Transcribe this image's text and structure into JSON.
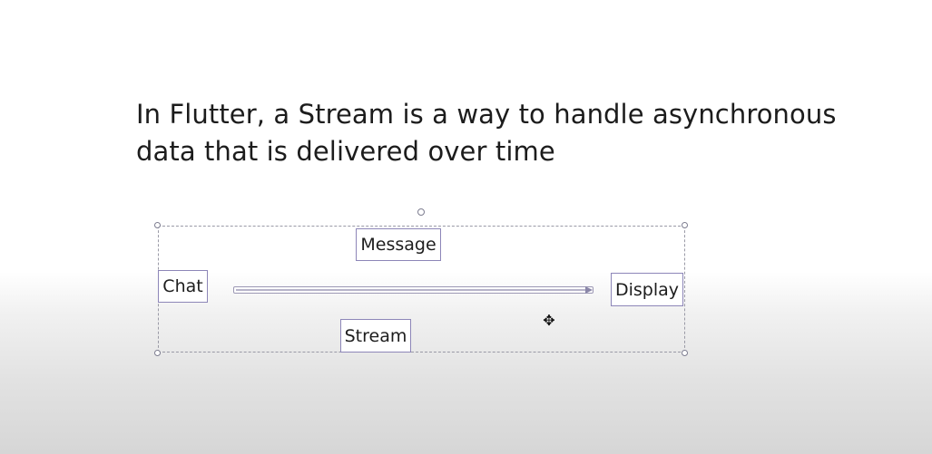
{
  "slide": {
    "title_line1": "In Flutter, a Stream is a way to handle asynchronous",
    "title_line2": "data that is delivered over time"
  },
  "diagram": {
    "nodes": {
      "message": "Message",
      "chat": "Chat",
      "display": "Display",
      "stream": "Stream"
    },
    "cursor_glyph": "✥"
  },
  "colors": {
    "node_border": "#8d86b8",
    "selection_border": "#9a9aa6",
    "text": "#1c1c1c"
  }
}
